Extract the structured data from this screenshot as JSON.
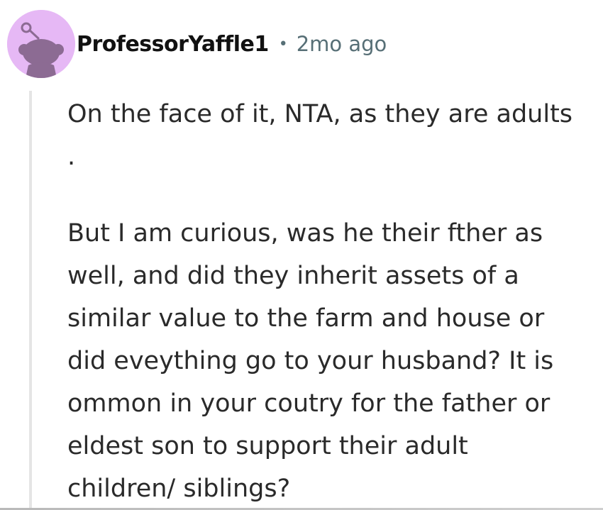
{
  "comment": {
    "avatar_icon": "reddit-snoo-avatar-icon",
    "avatar_color": "#e6b8f5",
    "author": "ProfessorYaffle1",
    "separator": "•",
    "time_ago": "2mo ago",
    "lines": [
      "On the face of it, NTA, as they are adults",
      ".",
      "But I am curious, was he their fther as",
      "well, and did they inherit assets of a",
      "similar value to the farm and house or",
      "did eveything go to your husband? It is",
      "ommon in your coutry for the father or",
      "eldest son to support their adult",
      "children/ siblings?"
    ]
  }
}
